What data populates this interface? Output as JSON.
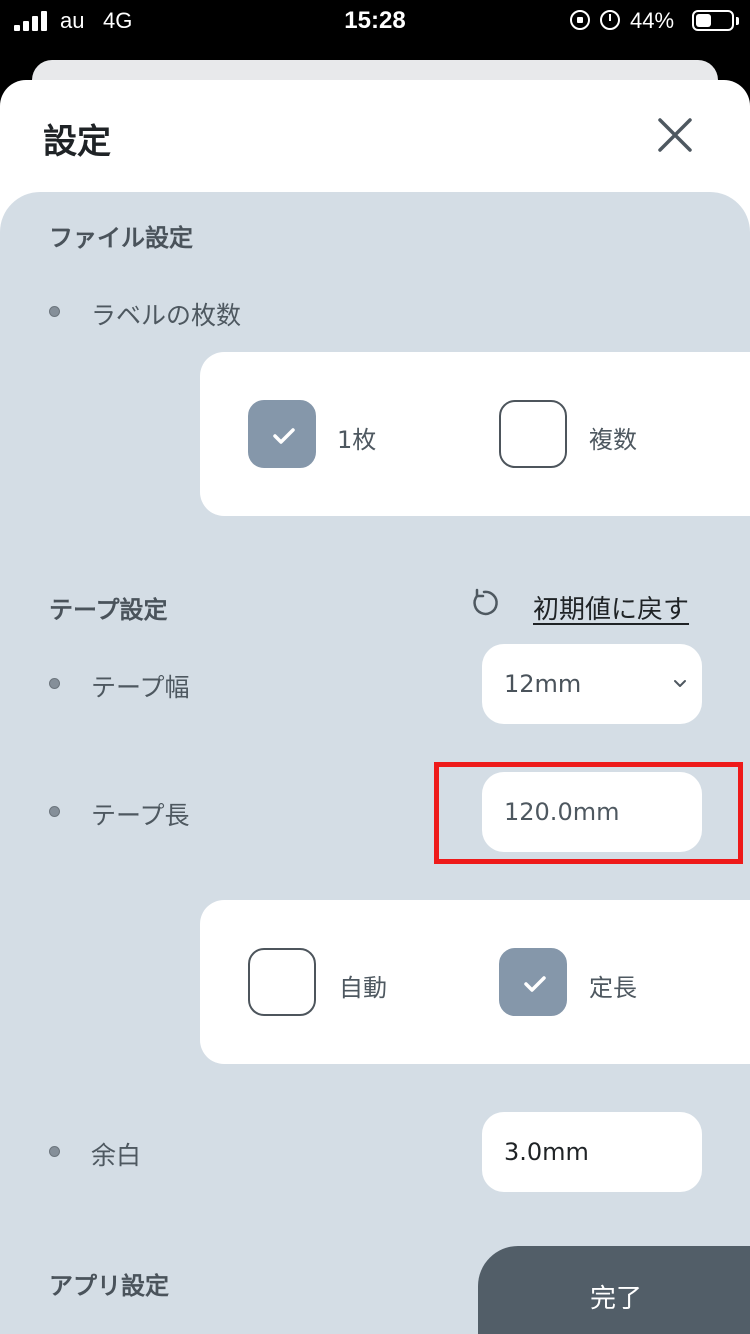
{
  "status_bar": {
    "carrier": "au",
    "network": "4G",
    "time": "15:28",
    "battery_percent": "44%",
    "battery_level": 0.44
  },
  "modal": {
    "title": "設定",
    "close_icon": "close-icon"
  },
  "file_settings": {
    "title": "ファイル設定",
    "label_count": {
      "label": "ラベルの枚数",
      "options": [
        {
          "label": "1枚",
          "checked": true
        },
        {
          "label": "複数",
          "checked": false
        }
      ]
    }
  },
  "tape_settings": {
    "title": "テープ設定",
    "reset_label": "初期値に戻す",
    "tape_width": {
      "label": "テープ幅",
      "value": "12mm"
    },
    "tape_length": {
      "label": "テープ長",
      "value": "120.0mm",
      "options": [
        {
          "label": "自動",
          "checked": false
        },
        {
          "label": "定長",
          "checked": true
        }
      ]
    },
    "margin": {
      "label": "余白",
      "value": "3.0mm"
    }
  },
  "app_settings": {
    "title": "アプリ設定"
  },
  "done_label": "完了",
  "colors": {
    "panel": "#d4dde5",
    "checked": "#8597aa",
    "highlight": "#ee1a1a",
    "done_button": "#525e68"
  }
}
